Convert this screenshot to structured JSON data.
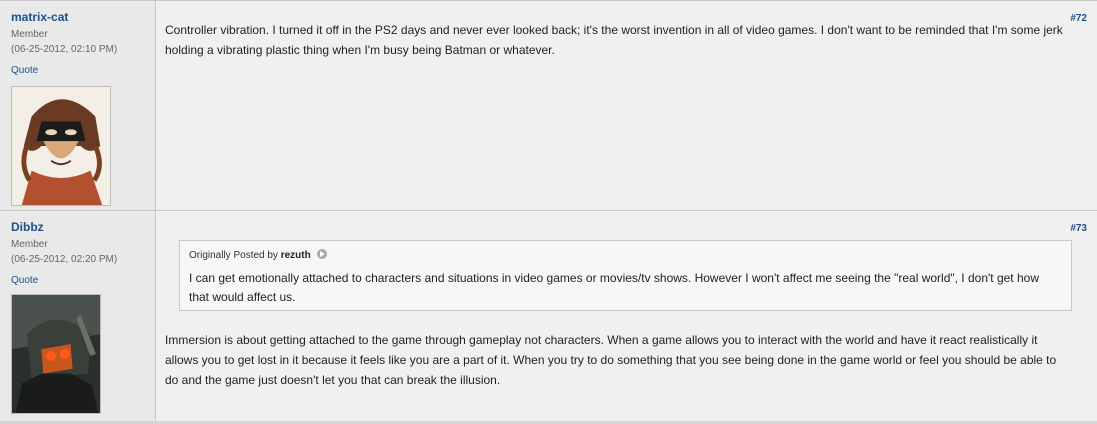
{
  "posts": [
    {
      "username": "matrix-cat",
      "usertitle": "Member",
      "timestamp": "(06-25-2012, 02:10 PM)",
      "quote_label": "Quote",
      "post_number": "#72",
      "message": "Controller vibration. I turned it off in the PS2 days and never ever looked back; it's the worst invention in all of video games. I don't want to be reminded that I'm some jerk holding a vibrating plastic thing when I'm busy being Batman or whatever."
    },
    {
      "username": "Dibbz",
      "usertitle": "Member",
      "timestamp": "(06-25-2012, 02:20 PM)",
      "quote_label": "Quote",
      "post_number": "#73",
      "quoted": {
        "prefix": "Originally Posted by",
        "author": "rezuth",
        "text": "I can get emotionally attached to characters and situations in video games or movies/tv shows. However I won't affect me seeing the \"real world\", I don't get how that would affect us."
      },
      "message": "Immersion is about getting attached to the game through gameplay not characters. When a game allows you to interact with the world and have it react realistically it allows you to get lost in it because it feels like you are a part of it. When you try to do something that you see being done in the game world or feel you should be able to do and the game just doesn't let you that can break the illusion."
    }
  ],
  "colors": {
    "link": "#1f4e8c",
    "user_col_bg": "#e9e9e9",
    "content_bg": "#f0f0f0"
  },
  "icons": {
    "view_post": "arrow-circle-icon"
  }
}
